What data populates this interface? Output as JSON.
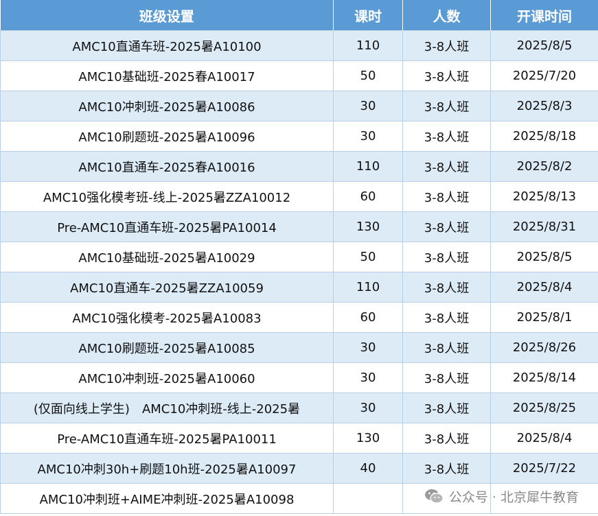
{
  "header": {
    "name": "班级设置",
    "hours": "课时",
    "size": "人数",
    "start": "开课时间"
  },
  "rows": [
    {
      "name": "AMC10直通车班-2025暑A10100",
      "hours": "110",
      "size": "3-8人班",
      "start": "2025/8/5"
    },
    {
      "name": "AMC10基础班-2025春A10017",
      "hours": "50",
      "size": "3-8人班",
      "start": "2025/7/20"
    },
    {
      "name": "AMC10冲刺班-2025暑A10086",
      "hours": "30",
      "size": "3-8人班",
      "start": "2025/8/3"
    },
    {
      "name": "AMC10刷题班-2025暑A10096",
      "hours": "30",
      "size": "3-8人班",
      "start": "2025/8/18"
    },
    {
      "name": "AMC10直通车-2025春A10016",
      "hours": "110",
      "size": "3-8人班",
      "start": "2025/8/2"
    },
    {
      "name": "AMC10强化模考班-线上-2025暑ZZA10012",
      "hours": "60",
      "size": "3-8人班",
      "start": "2025/8/13"
    },
    {
      "name": "Pre-AMC10直通车班-2025暑PA10014",
      "hours": "130",
      "size": "3-8人班",
      "start": "2025/8/31"
    },
    {
      "name": "AMC10基础班-2025暑A10029",
      "hours": "50",
      "size": "3-8人班",
      "start": "2025/8/5"
    },
    {
      "name": "AMC10直通车-2025暑ZZA10059",
      "hours": "110",
      "size": "3-8人班",
      "start": "2025/8/4"
    },
    {
      "name": "AMC10强化模考-2025暑A10083",
      "hours": "60",
      "size": "3-8人班",
      "start": "2025/8/1"
    },
    {
      "name": "AMC10刷题班-2025暑A10085",
      "hours": "30",
      "size": "3-8人班",
      "start": "2025/8/26"
    },
    {
      "name": "AMC10冲刺班-2025暑A10060",
      "hours": "30",
      "size": "3-8人班",
      "start": "2025/8/14"
    },
    {
      "name": "(仅面向线上学生)　AMC10冲刺班-线上-2025暑",
      "hours": "30",
      "size": "3-8人班",
      "start": "2025/8/25"
    },
    {
      "name": "Pre-AMC10直通车班-2025暑PA10011",
      "hours": "130",
      "size": "3-8人班",
      "start": "2025/8/4"
    },
    {
      "name": "AMC10冲刺30h+刷题10h班-2025暑A10097",
      "hours": "40",
      "size": "3-8人班",
      "start": "2025/7/22"
    },
    {
      "name": "AMC10冲刺班+AIME冲刺班-2025暑A10098",
      "hours": "",
      "size": "",
      "start": ""
    }
  ],
  "watermark": {
    "text": "公众号 · 北京犀牛教育",
    "icon": "wechat-icon"
  }
}
